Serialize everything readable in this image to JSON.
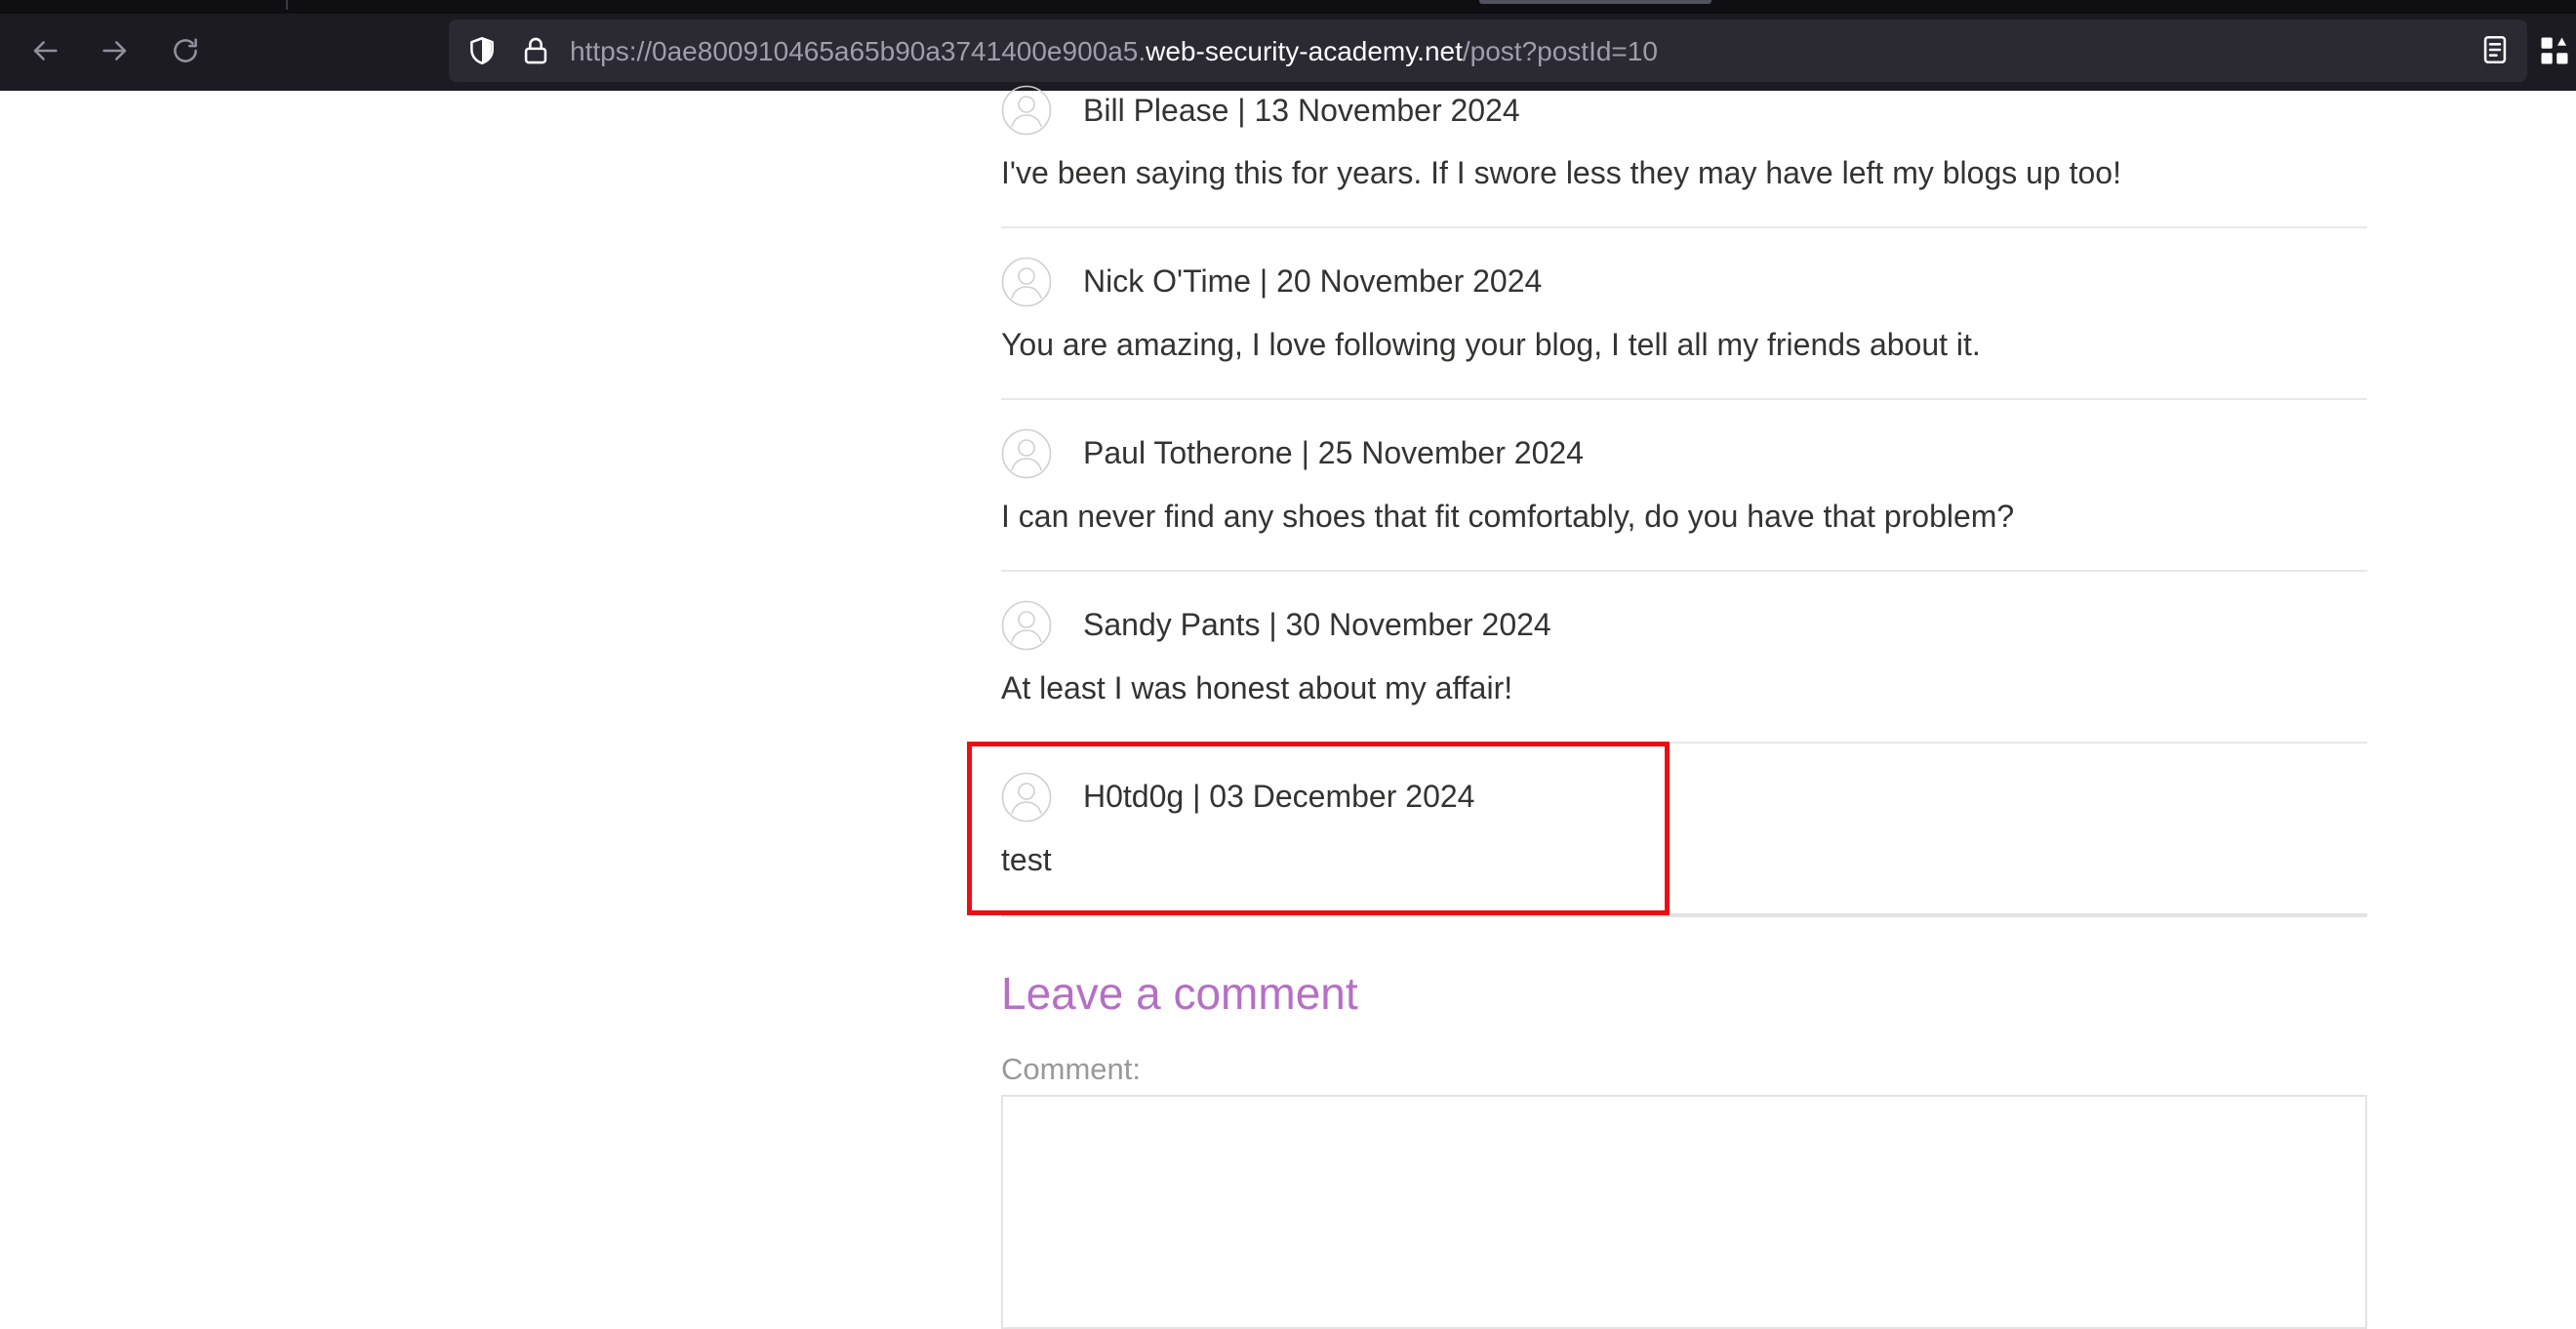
{
  "browser": {
    "url_prefix": "https://0ae800910465a65b90a3741400e900a5.",
    "url_host": "web-security-academy.net",
    "url_path": "/post?postId=10",
    "icons": [
      "back-arrow-icon",
      "forward-arrow-icon",
      "reload-icon",
      "shield-icon",
      "lock-icon",
      "reader-view-icon",
      "extensions-icon"
    ]
  },
  "comments": [
    {
      "author_line": "Bill Please | 13 November 2024",
      "text": "I've been saying this for years. If I swore less they may have left my blogs up too!"
    },
    {
      "author_line": "Nick O'Time | 20 November 2024",
      "text": "You are amazing, I love following your blog, I tell all my friends about it."
    },
    {
      "author_line": "Paul Totherone | 25 November 2024",
      "text": "I can never find any shoes that fit comfortably, do you have that problem?"
    },
    {
      "author_line": "Sandy Pants | 30 November 2024",
      "text": "At least I was honest about my affair!"
    },
    {
      "author_line": "H0td0g | 03 December 2024",
      "text": "test"
    }
  ],
  "form": {
    "heading": "Leave a comment",
    "comment_label": "Comment:"
  },
  "colors": {
    "chrome_bg": "#1c1b22",
    "urlbar_bg": "#2b2a33",
    "heading_purple": "#b66fc5",
    "highlight_red": "#ec0d14"
  }
}
